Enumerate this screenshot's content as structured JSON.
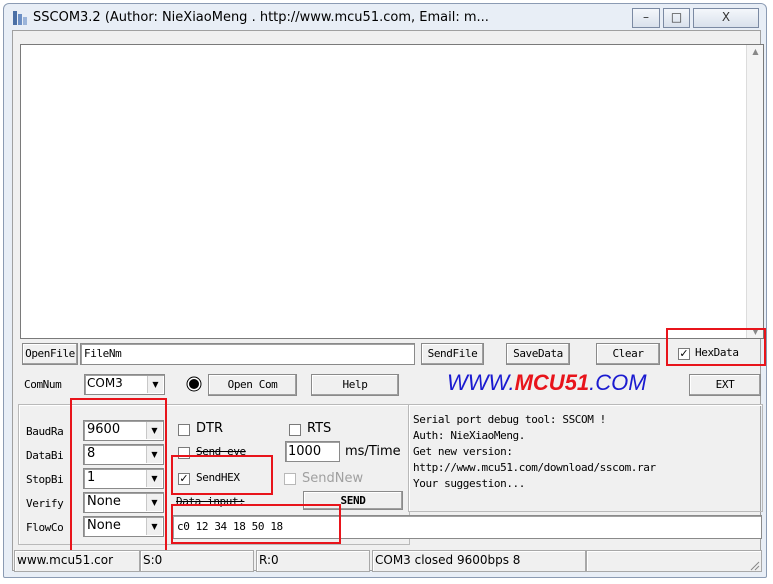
{
  "window": {
    "title": "SSCOM3.2 (Author: NieXiaoMeng . http://www.mcu51.com, Email: m...",
    "minimize_glyph": "–",
    "maximize_glyph": "□",
    "close_glyph": "X"
  },
  "file_row": {
    "open_file_label": "OpenFile",
    "file_name_value": "FileNm",
    "send_file_label": "SendFile",
    "save_data_label": "SaveData",
    "clear_label": "Clear",
    "hexdata_label": "HexData",
    "hexdata_checked": true
  },
  "port_row": {
    "comnum_label": "ComNum",
    "com_value": "COM3",
    "open_com_label": "Open Com",
    "help_label": "Help",
    "brand_text_1": "WWW.",
    "brand_text_2": "MCU51",
    "brand_text_3": ".COM",
    "ext_label": "EXT"
  },
  "settings": {
    "baud_label": "BaudRa",
    "baud_value": "9600",
    "databits_label": "DataBi",
    "databits_value": "8",
    "stopbits_label": "StopBi",
    "stopbits_value": "1",
    "verify_label": "Verify",
    "verify_value": "None",
    "flow_label": "FlowCo",
    "flow_value": "None"
  },
  "options": {
    "dtr_label": "DTR",
    "rts_label": "RTS",
    "send_every_label": "Send eve",
    "interval_value": "1000",
    "ms_time_label": "ms/Time",
    "sendhex_label": "SendHEX",
    "sendhex_checked": true,
    "sendnew_label": "SendNew",
    "data_input_label": "Data input:",
    "send_label": "SEND"
  },
  "info": {
    "lines": [
      "Serial port debug tool: SSCOM !",
      "Auth: NieXiaoMeng.",
      "Get new version:",
      "http://www.mcu51.com/download/sscom.rar",
      "Your suggestion..."
    ]
  },
  "data_input_value": "c0 12 34 18 50 18",
  "status_bar": {
    "site": "www.mcu51.cor",
    "sent": "S:0",
    "received": "R:0",
    "port_status": "COM3 closed  9600bps  8"
  },
  "colors": {
    "highlight_red": "#e8141b",
    "brand_blue": "#1a1ad0",
    "brand_red": "#e8141b"
  }
}
